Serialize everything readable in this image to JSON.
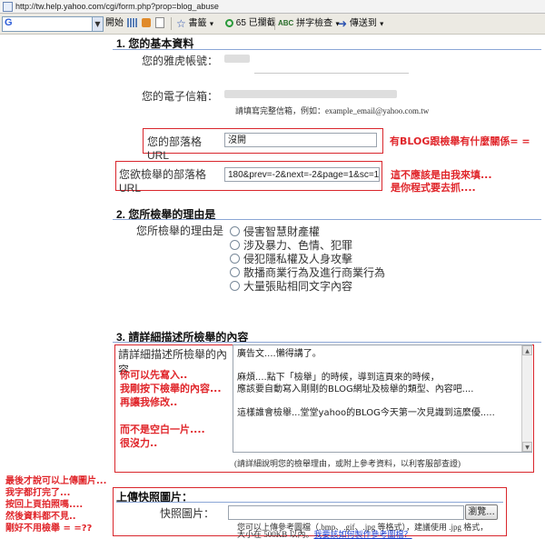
{
  "address_bar": {
    "url": "http://tw.help.yahoo.com/cgi/form.php?prop=blog_abuse"
  },
  "toolbar": {
    "search_engine": "G",
    "open_label": "開始",
    "bookmarks_label": "書籤",
    "blocked_label": "65 已攔截",
    "spellcheck_label": "拼字檢查",
    "sendto_label": "傳送到"
  },
  "section1": {
    "title": "1. 您的基本資料",
    "yahoo_id_label": "您的雅虎帳號：",
    "email_label": "您的電子信箱：",
    "email_hint": "請填寫完整信箱，例如：example_email@yahoo.com.tw",
    "blog_url_label": "您的部落格URL",
    "blog_url_value": "沒開",
    "report_url_label": "您欲檢舉的部落格URL",
    "report_url_value": "180&prev=-2&next=-2&page=1&sc=1#yartcmt"
  },
  "section2": {
    "title": "2. 您所檢舉的理由是",
    "reason_label": "您所檢舉的理由是",
    "options": [
      "侵害智慧財產權",
      "涉及暴力、色情、犯罪",
      "侵犯隱私權及人身攻擊",
      "散播商業行為及進行商業行為",
      "大量張貼相同文字內容"
    ]
  },
  "section3": {
    "title": "3. 請詳細描述所檢舉的內容",
    "desc_label": "請詳細描述所檢舉的內容",
    "textarea_lines": [
      "廣告文....懶得講了。",
      "",
      "麻煩....點下「檢舉」的時候，導到這頁來的時候，",
      "應該要自動寫入剛剛的BLOG網址及檢舉的類型、內容吧....",
      "",
      "這樣誰會檢舉...堂堂yahoo的BLOG今天第一次見識到這麼優....."
    ],
    "desc_hint": "(請詳細說明您的檢舉理由，或附上參考資料，以利客服部查證)"
  },
  "section4": {
    "title": "上傳快照圖片：",
    "image_label": "快照圖片：",
    "browse_label": "瀏覽...",
    "hint_line1": "您可以上傳參考圖檔（.bmp、.gif、.jpg 等格式），建議使用 .jpg 格式，",
    "hint_line2_prefix": "大小在 500KB 以內。",
    "hint_link": "我要該如何製作參考圖檔？"
  },
  "annotations": {
    "note1": "有BLOG跟檢舉有什麼關係= =",
    "note2_lines": [
      "這不應該是由我來填...",
      "是你程式要去抓...."
    ],
    "note3_lines": [
      "你可以先寫入..",
      "我剛按下檢舉的內容...",
      "再讓我修改..",
      "",
      "而不是空白一片....",
      "很沒力.."
    ],
    "note4_lines": [
      "最後才說可以上傳圖片...",
      "我字都打完了...",
      "按回上頁拍照嗎....",
      "然後資料都不見..",
      "剛好不用檢舉 = =??"
    ]
  },
  "colors": {
    "annotation_red": "#e0252a",
    "section_line": "#8ba6d6",
    "link_blue": "#1a3fd1"
  }
}
